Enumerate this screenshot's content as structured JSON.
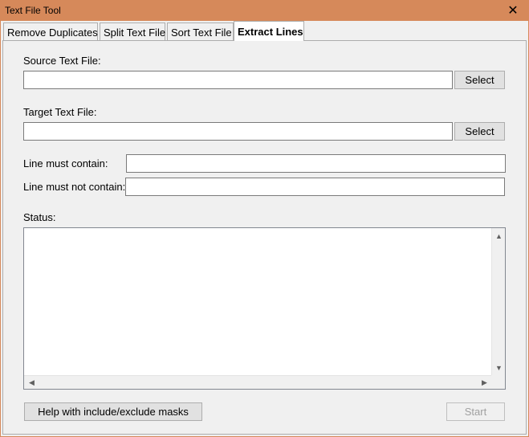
{
  "window": {
    "title": "Text File Tool",
    "close_glyph": "✕"
  },
  "tabs": [
    {
      "label": "Remove Duplicates",
      "active": false
    },
    {
      "label": "Split Text File",
      "active": false
    },
    {
      "label": "Sort Text File",
      "active": false
    },
    {
      "label": "Extract Lines",
      "active": true
    }
  ],
  "form": {
    "source_label": "Source Text File:",
    "source_value": "",
    "source_select_label": "Select",
    "target_label": "Target Text File:",
    "target_value": "",
    "target_select_label": "Select",
    "must_contain_label": "Line must contain:",
    "must_contain_value": "",
    "must_not_contain_label": "Line must not contain:",
    "must_not_contain_value": "",
    "status_label": "Status:",
    "status_value": ""
  },
  "footer": {
    "help_label": "Help with include/exclude masks",
    "start_label": "Start"
  },
  "icons": {
    "up": "▲",
    "down": "▼",
    "left": "◀",
    "right": "▶"
  }
}
